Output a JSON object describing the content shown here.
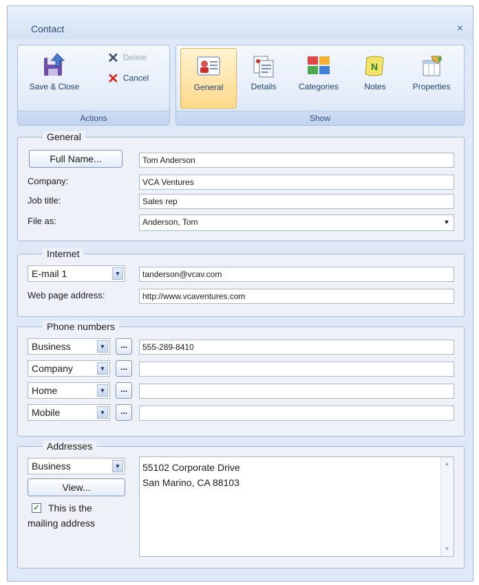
{
  "window": {
    "title": "Contact",
    "close": "×"
  },
  "ribbon": {
    "actions": {
      "group_label": "Actions",
      "save_close": "Save & Close",
      "delete": "Delete",
      "cancel": "Cancel"
    },
    "show": {
      "group_label": "Show",
      "buttons": [
        {
          "label": "General",
          "active": true
        },
        {
          "label": "Details"
        },
        {
          "label": "Categories"
        },
        {
          "label": "Notes"
        },
        {
          "label": "Properties"
        }
      ]
    }
  },
  "general": {
    "legend": "General",
    "full_name_button": "Full Name...",
    "full_name_value": "Tom Anderson",
    "company_label": "Company:",
    "company_value": "VCA Ventures",
    "job_title_label": "Job title:",
    "job_title_value": "Sales rep",
    "file_as_label": "File as:",
    "file_as_value": "Anderson, Tom"
  },
  "internet": {
    "legend": "Internet",
    "email_type": "E-mail 1",
    "email_value": "tanderson@vcav.com",
    "web_label": "Web page address:",
    "web_value": "http://www.vcaventures.com"
  },
  "phones": {
    "legend": "Phone numbers",
    "dots": "...",
    "rows": [
      {
        "type": "Business",
        "value": "555-289-8410"
      },
      {
        "type": "Company",
        "value": ""
      },
      {
        "type": "Home",
        "value": ""
      },
      {
        "type": "Mobile",
        "value": ""
      }
    ]
  },
  "addresses": {
    "legend": "Addresses",
    "type": "Business",
    "view_button": "View...",
    "mailing_label_1": "This is the",
    "mailing_label_2": "mailing address",
    "mailing_checked": true,
    "line1": "55102 Corporate Drive",
    "line2": "San Marino, CA 88103"
  }
}
